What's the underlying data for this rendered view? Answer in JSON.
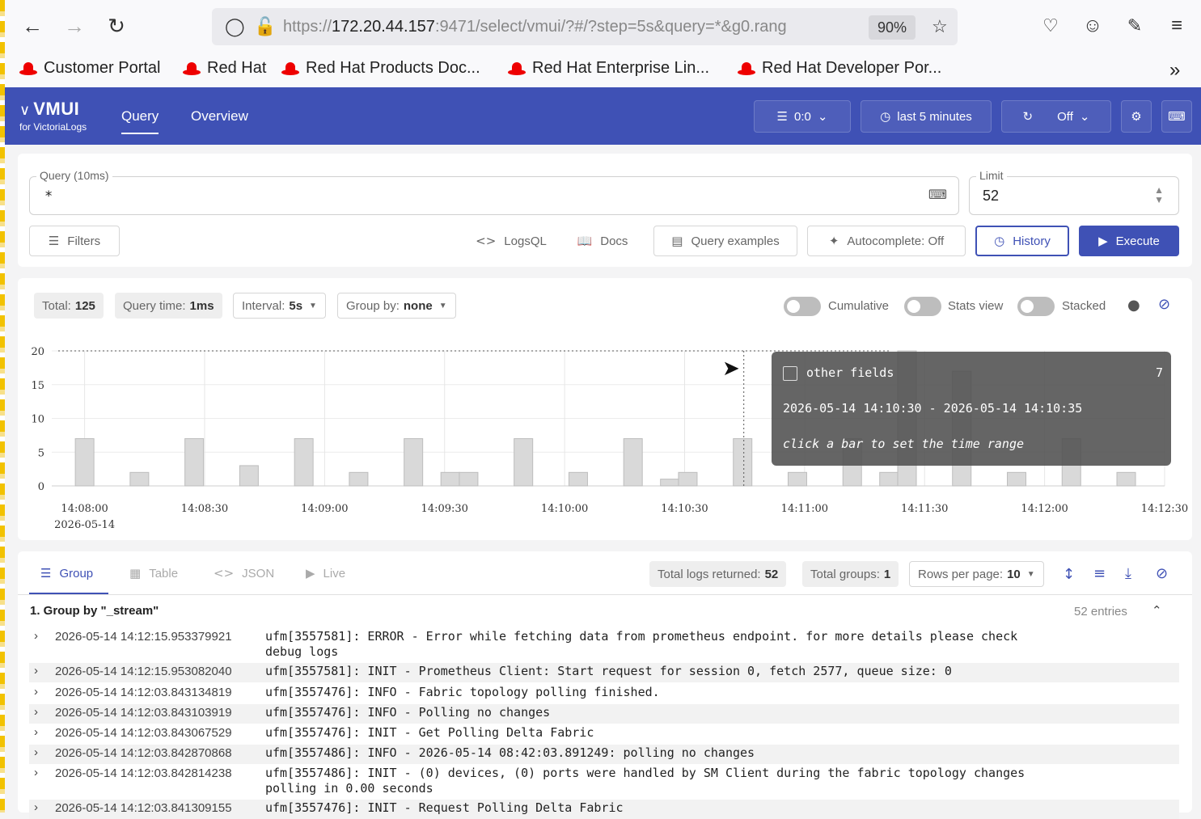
{
  "browser": {
    "url_prefix": "https://",
    "url_host": "172.20.44.157",
    "url_rest": ":9471/select/vmui/?#/?step=5s&query=*&g0.rang",
    "zoom": "90%"
  },
  "bookmarks": [
    "Customer Portal",
    "Red Hat",
    "Red Hat Products Doc...",
    "Red Hat Enterprise Lin...",
    "Red Hat Developer Por..."
  ],
  "app": {
    "logo": "VMUI",
    "logo_sub": "for VictoriaLogs",
    "nav": [
      "Query",
      "Overview"
    ],
    "tenant": "0:0",
    "time_range": "last 5 minutes",
    "refresh": "Off"
  },
  "query": {
    "label": "Query (10ms)",
    "value": "*",
    "limit_label": "Limit",
    "limit_value": "52",
    "filters": "Filters",
    "logsql": "LogsQL",
    "docs": "Docs",
    "examples": "Query examples",
    "autocomplete": "Autocomplete: Off",
    "history": "History",
    "execute": "Execute"
  },
  "stats": {
    "total_label": "Total:",
    "total": "125",
    "query_time_label": "Query time:",
    "query_time": "1ms",
    "interval_label": "Interval:",
    "interval": "5s",
    "group_label": "Group by:",
    "group": "none",
    "cumulative": "Cumulative",
    "stats_view": "Stats view",
    "stacked": "Stacked"
  },
  "chart_data": {
    "type": "bar",
    "y_ticks": [
      "0",
      "5",
      "10",
      "15",
      "20"
    ],
    "ylim": [
      0,
      20
    ],
    "x_ticks": [
      "14:08:00",
      "14:08:30",
      "14:09:00",
      "14:09:30",
      "14:10:00",
      "14:10:30",
      "14:11:00",
      "14:11:30",
      "14:12:00",
      "14:12:30"
    ],
    "x_date": "2026-05-14",
    "bars": [
      {
        "t": 0,
        "v": 7
      },
      {
        "t": 13.7,
        "v": 2
      },
      {
        "t": 27.4,
        "v": 7
      },
      {
        "t": 41.1,
        "v": 3
      },
      {
        "t": 54.8,
        "v": 7
      },
      {
        "t": 68.5,
        "v": 2
      },
      {
        "t": 82.2,
        "v": 7
      },
      {
        "t": 91.4,
        "v": 2
      },
      {
        "t": 96.0,
        "v": 2
      },
      {
        "t": 109.7,
        "v": 7
      },
      {
        "t": 123.4,
        "v": 2
      },
      {
        "t": 137.1,
        "v": 7
      },
      {
        "t": 146.3,
        "v": 1
      },
      {
        "t": 150.8,
        "v": 2
      },
      {
        "t": 164.5,
        "v": 7
      },
      {
        "t": 178.2,
        "v": 2
      },
      {
        "t": 191.9,
        "v": 7
      },
      {
        "t": 201.1,
        "v": 2
      },
      {
        "t": 205.6,
        "v": 20
      },
      {
        "t": 219.3,
        "v": 17
      },
      {
        "t": 233.0,
        "v": 2
      },
      {
        "t": 246.7,
        "v": 7
      },
      {
        "t": 260.4,
        "v": 2
      }
    ],
    "hover_line": 20,
    "tooltip": {
      "series": "other fields",
      "value": "7",
      "range": "2026-05-14 14:10:30 - 2026-05-14 14:10:35",
      "hint": "click a bar to set the time range"
    }
  },
  "logs": {
    "tabs": [
      "Group",
      "Table",
      "JSON",
      "Live"
    ],
    "total_returned_label": "Total logs returned:",
    "total_returned": "52",
    "total_groups_label": "Total groups:",
    "total_groups": "1",
    "rows_per_page_label": "Rows per page:",
    "rows_per_page": "10",
    "group_title": "1. Group by \"_stream\"",
    "entries": "52 entries",
    "rows": [
      {
        "ts": "2026-05-14 14:12:15.953379921",
        "msg": "ufm[3557581]: ERROR - Error while fetching data from prometheus endpoint. for more details please check\ndebug logs"
      },
      {
        "ts": "2026-05-14 14:12:15.953082040",
        "msg": "ufm[3557581]: INIT - Prometheus Client: Start request for session 0, fetch 2577, queue size: 0"
      },
      {
        "ts": "2026-05-14 14:12:03.843134819",
        "msg": "ufm[3557476]: INFO - Fabric topology polling finished."
      },
      {
        "ts": "2026-05-14 14:12:03.843103919",
        "msg": "ufm[3557476]: INFO - Polling no changes"
      },
      {
        "ts": "2026-05-14 14:12:03.843067529",
        "msg": "ufm[3557476]: INIT - Get Polling Delta Fabric"
      },
      {
        "ts": "2026-05-14 14:12:03.842870868",
        "msg": "ufm[3557486]: INFO - 2026-05-14 08:42:03.891249: polling no changes"
      },
      {
        "ts": "2026-05-14 14:12:03.842814238",
        "msg": "ufm[3557486]: INIT - (0) devices, (0) ports were handled by SM Client during the fabric topology changes\npolling in 0.00 seconds"
      },
      {
        "ts": "2026-05-14 14:12:03.841309155",
        "msg": "ufm[3557476]: INIT - Request Polling Delta Fabric"
      }
    ]
  }
}
